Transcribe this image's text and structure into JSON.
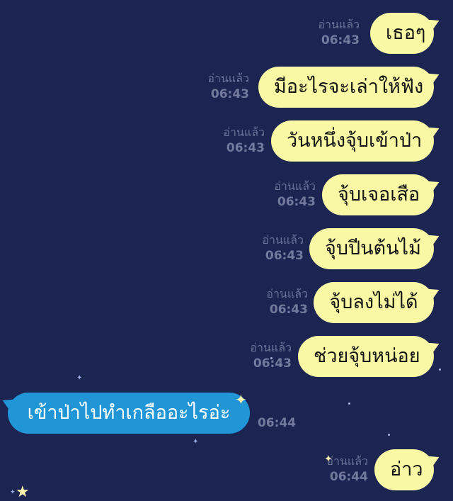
{
  "read_label": "อ่านแล้ว",
  "messages": [
    {
      "dir": "out",
      "text": "เธอๆ",
      "time": "06:43"
    },
    {
      "dir": "out",
      "text": "มีอะไรจะเล่าให้ฟัง",
      "time": "06:43"
    },
    {
      "dir": "out",
      "text": "วันหนึ่งจุ้บเข้าป่า",
      "time": "06:43"
    },
    {
      "dir": "out",
      "text": "จุ้บเจอเสือ",
      "time": "06:43"
    },
    {
      "dir": "out",
      "text": "จุ้บปีนต้นไม้",
      "time": "06:43"
    },
    {
      "dir": "out",
      "text": "จุ้บลงไม่ได้",
      "time": "06:43"
    },
    {
      "dir": "out",
      "text": "ช่วยจุ้บหน่อย",
      "time": "06:43"
    },
    {
      "dir": "in",
      "text": "เข้าป่าไปทำเกลืออะไรอ่ะ",
      "time": "06:44"
    },
    {
      "dir": "out",
      "text": "อ่าว",
      "time": "06:44"
    }
  ],
  "colors": {
    "background": "#1c2452",
    "outgoing_bubble": "#f9f9a5",
    "incoming_bubble": "#2196d6",
    "meta_text": "#6a7396"
  },
  "decorations": [
    "star-icon",
    "sparkle-icon"
  ]
}
